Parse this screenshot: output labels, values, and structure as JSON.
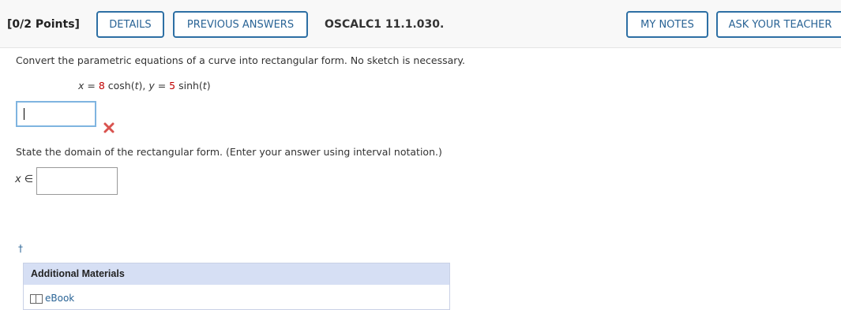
{
  "header": {
    "points": "[0/2 Points]",
    "details_label": "DETAILS",
    "previous_answers_label": "PREVIOUS ANSWERS",
    "question_id": "OSCALC1 11.1.030.",
    "my_notes_label": "MY NOTES",
    "ask_teacher_label": "ASK YOUR TEACHER"
  },
  "question": {
    "prompt1": "Convert the parametric equations of a curve into rectangular form. No sketch is necessary.",
    "equation": {
      "x_var": "x",
      "eq1": " = ",
      "x_coef": "8",
      "x_func": " cosh(",
      "t1": "t",
      "close1": "),  ",
      "y_var": "y",
      "eq2": " = ",
      "y_coef": "5",
      "y_func": " sinh(",
      "t2": "t",
      "close2": ")"
    },
    "answer1_value": "",
    "prompt2": "State the domain of the rectangular form. (Enter your answer using interval notation.)",
    "domain_var": "x",
    "domain_symbol": " ∈",
    "answer2_value": ""
  },
  "footnote_symbol": "†",
  "materials": {
    "heading": "Additional Materials",
    "ebook_label": "eBook"
  },
  "colors": {
    "accent": "#2a6496",
    "coefficient_red": "#c00000",
    "wrong_mark": "#d9534f"
  }
}
